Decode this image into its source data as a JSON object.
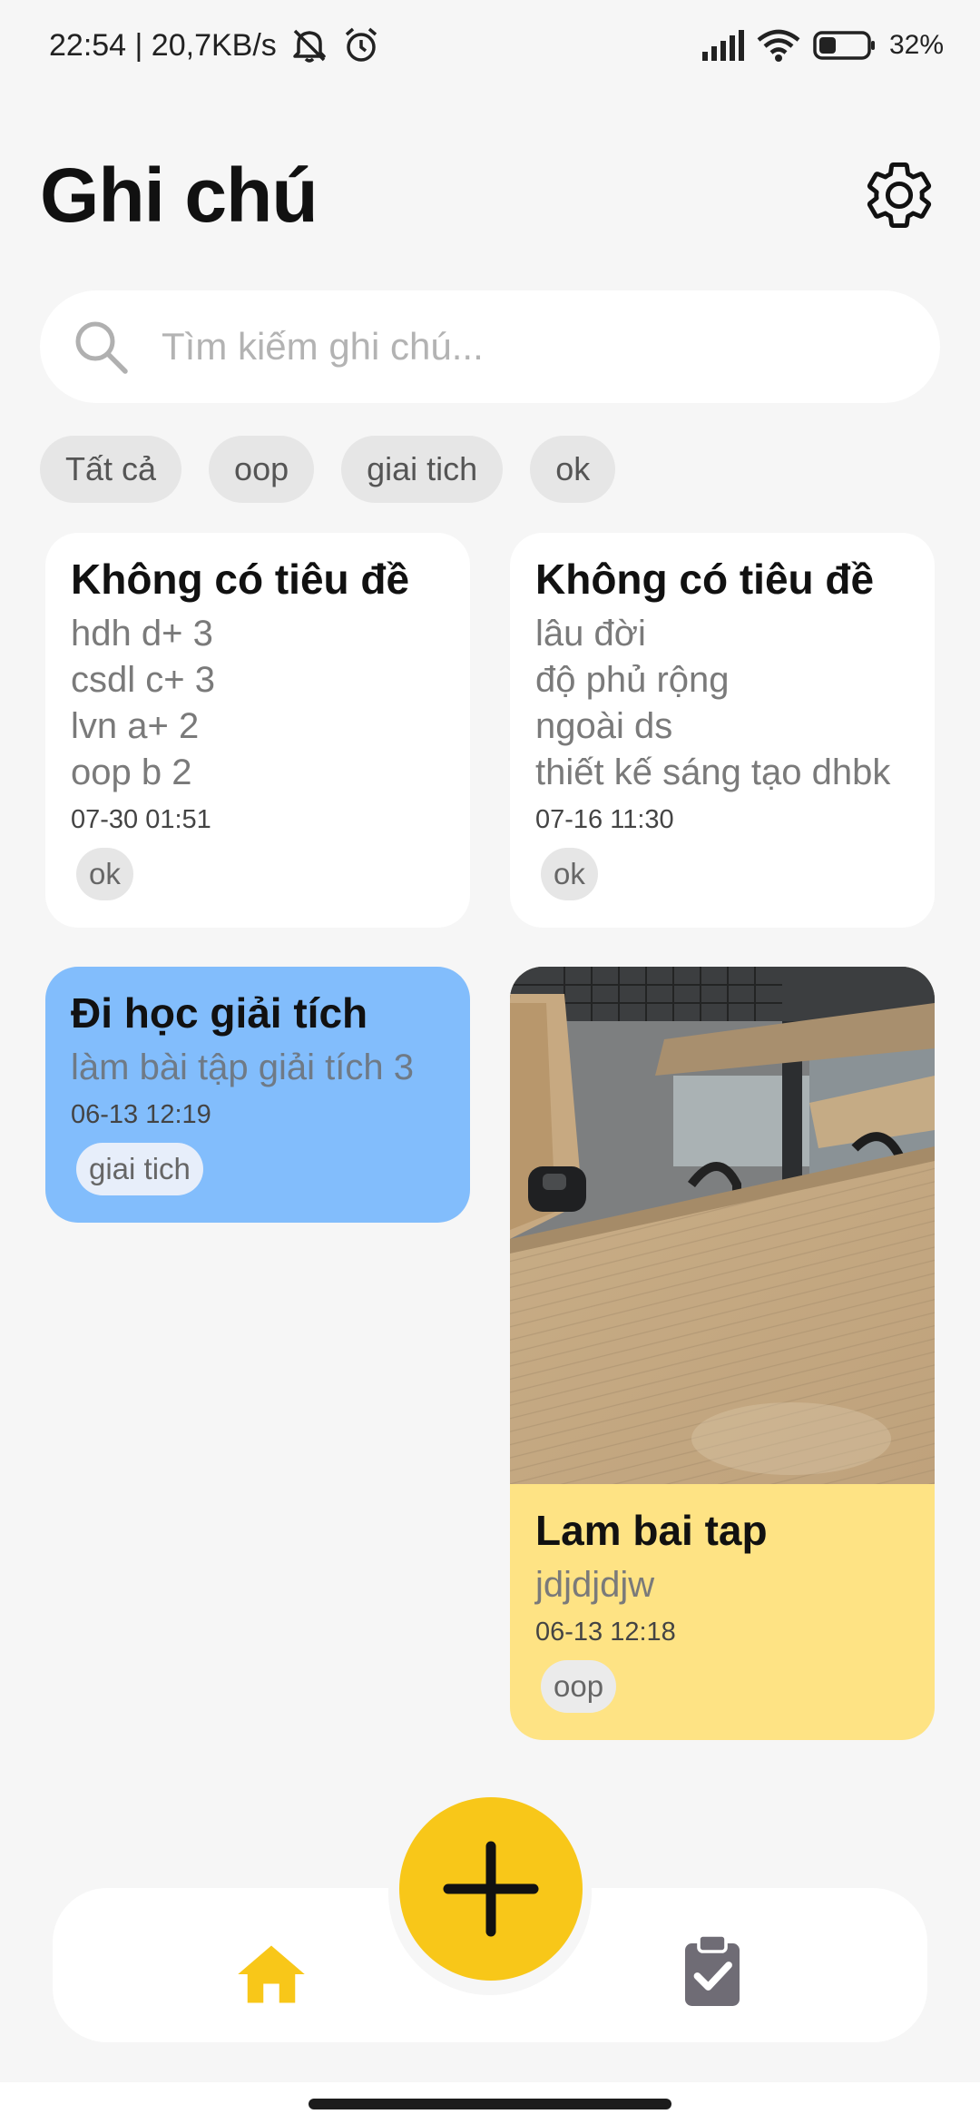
{
  "status_bar": {
    "time_info": "22:54 | 20,7KB/s",
    "battery": "32%",
    "icons": [
      "mute-icon",
      "alarm-icon",
      "signal-icon",
      "wifi-icon",
      "battery-icon"
    ]
  },
  "header": {
    "title": "Ghi chú",
    "settings_icon": "gear-icon"
  },
  "search": {
    "placeholder": "Tìm kiếm ghi chú...",
    "value": "",
    "icon": "search-icon"
  },
  "filters": [
    "Tất cả",
    "oop",
    "giai tich",
    "ok"
  ],
  "notes": [
    {
      "title": "Không có tiêu đề",
      "lines": [
        "hdh d+ 3",
        "csdl c+ 3",
        "lvn a+ 2",
        "oop b 2"
      ],
      "date": "07-30 01:51",
      "tag": "ok",
      "color": "#ffffff"
    },
    {
      "title": "Không có tiêu đề",
      "lines": [
        "lâu đời",
        "độ phủ rộng",
        "ngoài ds",
        "thiết kế sáng tạo dhbk"
      ],
      "date": "07-16 11:30",
      "tag": "ok",
      "color": "#ffffff"
    },
    {
      "title": "Đi học giải tích",
      "lines": [
        "làm bài tập giải tích 3"
      ],
      "date": "06-13 12:19",
      "tag": "giai tich",
      "color": "#82bdfc"
    },
    {
      "title": "Lam bai tap",
      "lines": [
        "jdjdjdjw"
      ],
      "date": "06-13 12:18",
      "tag": "oop",
      "color": "#fee384",
      "has_image": true
    }
  ],
  "nav": {
    "home_icon": "home-icon",
    "tasks_icon": "clipboard-check-icon",
    "fab_icon": "plus-icon",
    "accent": "#f8c719",
    "inactive": "#6f6c75"
  }
}
